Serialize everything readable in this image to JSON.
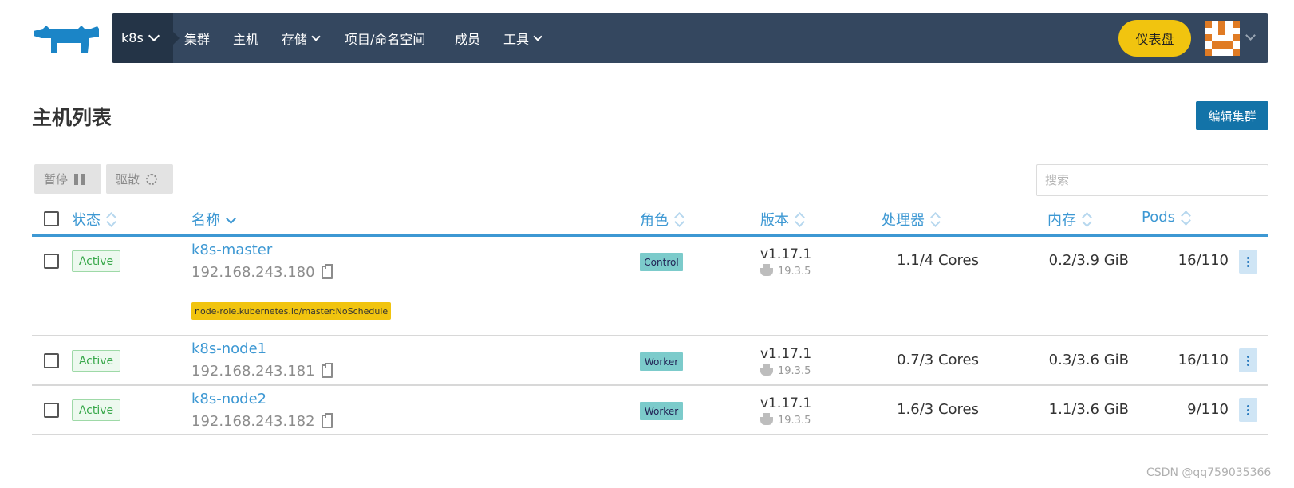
{
  "nav": {
    "cluster": "k8s",
    "items": [
      {
        "label": "集群"
      },
      {
        "label": "主机"
      },
      {
        "label": "存储"
      },
      {
        "label": "项目/命名空间"
      },
      {
        "label": "成员"
      },
      {
        "label": "工具"
      }
    ],
    "dashboard_label": "仪表盘"
  },
  "page": {
    "title": "主机列表",
    "edit_cluster_label": "编辑集群"
  },
  "bulk_actions": {
    "pause_label": "暂停",
    "drain_label": "驱散"
  },
  "search": {
    "placeholder": "搜索",
    "value": ""
  },
  "table": {
    "columns": [
      "状态",
      "名称",
      "角色",
      "版本",
      "处理器",
      "内存",
      "Pods"
    ],
    "rows": [
      {
        "state": "Active",
        "name": "k8s-master",
        "ip": "192.168.243.180",
        "taint": "node-role.kubernetes.io/master:NoSchedule",
        "role": "Control",
        "version": "v1.17.1",
        "docker": "19.3.5",
        "cpu": "1.1/4 Cores",
        "memory": "0.2/3.9 GiB",
        "pods": "16/110"
      },
      {
        "state": "Active",
        "name": "k8s-node1",
        "ip": "192.168.243.181",
        "role": "Worker",
        "version": "v1.17.1",
        "docker": "19.3.5",
        "cpu": "0.7/3 Cores",
        "memory": "0.3/3.6 GiB",
        "pods": "16/110"
      },
      {
        "state": "Active",
        "name": "k8s-node2",
        "ip": "192.168.243.182",
        "role": "Worker",
        "version": "v1.17.1",
        "docker": "19.3.5",
        "cpu": "1.6/3 Cores",
        "memory": "1.1/3.6 GiB",
        "pods": "9/110"
      }
    ]
  },
  "colors": {
    "nav_bg": "#34475f",
    "accent": "#3d98d3",
    "primary_button": "#1373a8",
    "dashboard_button": "#f1c40f",
    "active_green": "#39a84b",
    "role_badge": "#7ccbcb"
  },
  "watermark": "CSDN @qq759035366"
}
